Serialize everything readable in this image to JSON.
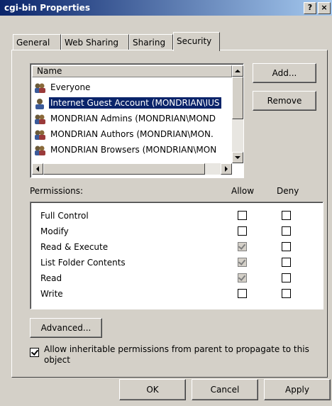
{
  "window": {
    "title": "cgi-bin Properties",
    "help_label": "?",
    "close_label": "×"
  },
  "tabs": [
    {
      "label": "General"
    },
    {
      "label": "Web Sharing"
    },
    {
      "label": "Sharing"
    },
    {
      "label": "Security"
    }
  ],
  "names": {
    "header": "Name",
    "items": [
      {
        "label": "Everyone",
        "icon": "group-icon"
      },
      {
        "label": "Internet Guest Account (MONDRIAN\\IUS",
        "icon": "user-icon",
        "selected": true
      },
      {
        "label": "MONDRIAN Admins (MONDRIAN\\MOND",
        "icon": "group-icon"
      },
      {
        "label": "MONDRIAN Authors (MONDRIAN\\MON.",
        "icon": "group-icon"
      },
      {
        "label": "MONDRIAN Browsers (MONDRIAN\\MON",
        "icon": "group-icon"
      }
    ]
  },
  "buttons": {
    "add": "Add...",
    "remove": "Remove",
    "advanced": "Advanced...",
    "ok": "OK",
    "cancel": "Cancel",
    "apply": "Apply"
  },
  "permissions": {
    "label": "Permissions:",
    "allow_header": "Allow",
    "deny_header": "Deny",
    "rows": [
      {
        "name": "Full Control",
        "allow": "unchecked",
        "deny": "unchecked"
      },
      {
        "name": "Modify",
        "allow": "unchecked",
        "deny": "unchecked"
      },
      {
        "name": "Read & Execute",
        "allow": "checked-disabled",
        "deny": "unchecked"
      },
      {
        "name": "List Folder Contents",
        "allow": "checked-disabled",
        "deny": "unchecked"
      },
      {
        "name": "Read",
        "allow": "checked-disabled",
        "deny": "unchecked"
      },
      {
        "name": "Write",
        "allow": "unchecked",
        "deny": "unchecked"
      }
    ]
  },
  "inherit": {
    "line1": "Allow inheritable permissions from parent to propagate to this",
    "line2": "object",
    "checked": true
  },
  "colors": {
    "face": "#d4d0c8",
    "title_start": "#0a246a",
    "title_end": "#a6caf0",
    "selection": "#0a246a"
  }
}
